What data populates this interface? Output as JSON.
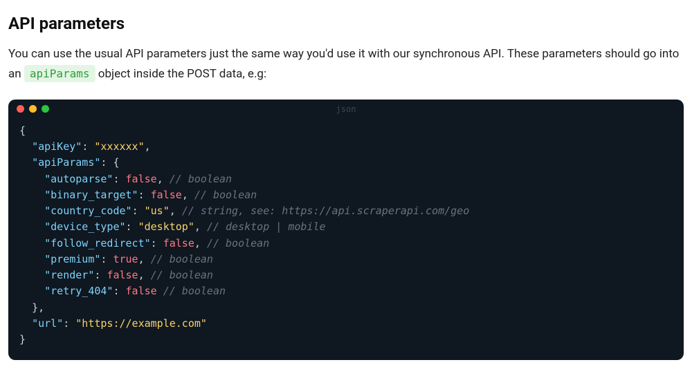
{
  "heading": "API parameters",
  "intro_before": "You can use the usual API parameters just the same way you'd use it with our synchronous API. These parameters should go into an ",
  "intro_code": "apiParams",
  "intro_after": " object inside the POST data, e.g:",
  "code": {
    "language_label": "json",
    "open": "{",
    "apiKey_key": "\"apiKey\"",
    "apiKey_val": "\"xxxxxx\"",
    "apiParams_key": "\"apiParams\"",
    "apiParams_open": "{",
    "rows": {
      "autoparse": {
        "key": "\"autoparse\"",
        "val": "false",
        "valClass": "b",
        "comma": ",",
        "comment": "// boolean"
      },
      "binary_target": {
        "key": "\"binary_target\"",
        "val": "false",
        "valClass": "b",
        "comma": ",",
        "comment": "// boolean"
      },
      "country_code": {
        "key": "\"country_code\"",
        "val": "\"us\"",
        "valClass": "s",
        "comma": ",",
        "comment": "// string, see: https://api.scraperapi.com/geo"
      },
      "device_type": {
        "key": "\"device_type\"",
        "val": "\"desktop\"",
        "valClass": "s",
        "comma": ",",
        "comment": "// desktop | mobile"
      },
      "follow_redirect": {
        "key": "\"follow_redirect\"",
        "val": "false",
        "valClass": "b",
        "comma": ",",
        "comment": "// boolean"
      },
      "premium": {
        "key": "\"premium\"",
        "val": "true",
        "valClass": "b",
        "comma": ",",
        "comment": "// boolean"
      },
      "render": {
        "key": "\"render\"",
        "val": "false",
        "valClass": "b",
        "comma": ",",
        "comment": "// boolean"
      },
      "retry_404": {
        "key": "\"retry_404\"",
        "val": "false",
        "valClass": "b",
        "comma": "",
        "comment": "// boolean"
      }
    },
    "apiParams_close": "},",
    "url_key": "\"url\"",
    "url_val": "\"https://example.com\"",
    "close": "}"
  }
}
